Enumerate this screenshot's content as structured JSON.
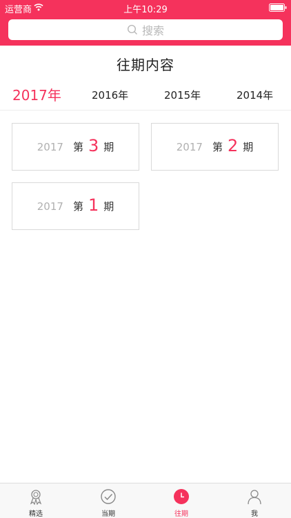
{
  "status_bar": {
    "carrier": "运营商",
    "time": "上午10:29"
  },
  "search": {
    "placeholder": "搜索"
  },
  "page_title": "往期内容",
  "years": [
    {
      "label": "2017年",
      "active": true
    },
    {
      "label": "2016年",
      "active": false
    },
    {
      "label": "2015年",
      "active": false
    },
    {
      "label": "2014年",
      "active": false
    }
  ],
  "issues": [
    {
      "year": "2017",
      "prefix": "第",
      "number": "3",
      "suffix": "期"
    },
    {
      "year": "2017",
      "prefix": "第",
      "number": "2",
      "suffix": "期"
    },
    {
      "year": "2017",
      "prefix": "第",
      "number": "1",
      "suffix": "期"
    }
  ],
  "tab_bar": {
    "items": [
      {
        "label": "精选",
        "icon": "award-icon",
        "active": false
      },
      {
        "label": "当期",
        "icon": "check-circle-icon",
        "active": false
      },
      {
        "label": "往期",
        "icon": "clock-icon",
        "active": true
      },
      {
        "label": "我",
        "icon": "user-icon",
        "active": false
      }
    ]
  },
  "colors": {
    "accent": "#f5325c",
    "muted_text": "#b0b0b0",
    "border": "#d9d9d9"
  }
}
